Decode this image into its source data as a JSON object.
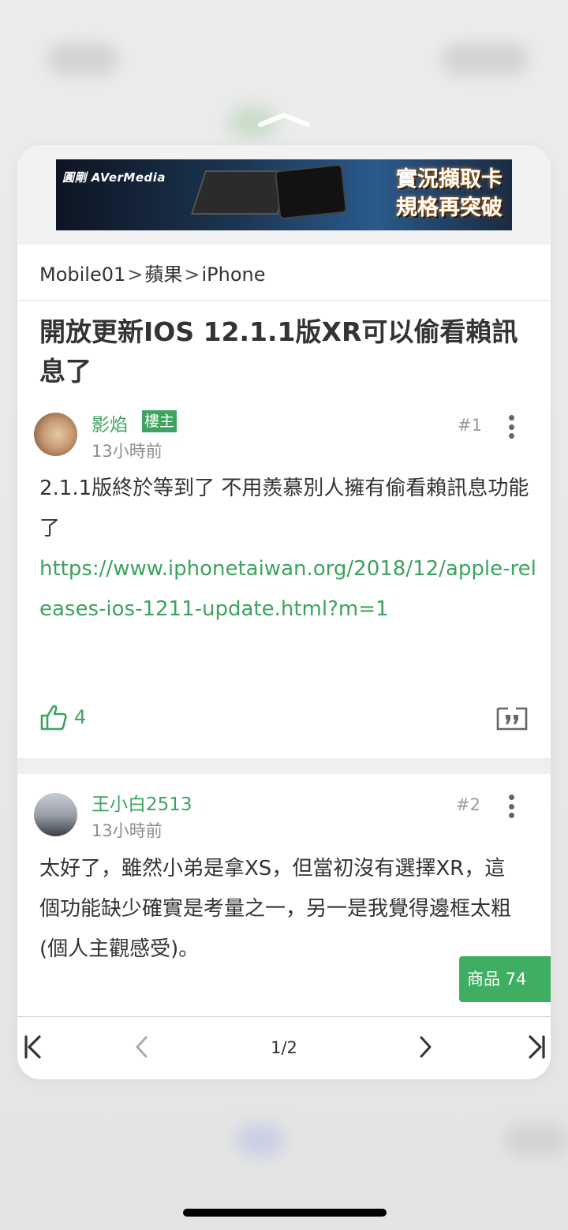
{
  "ad": {
    "brand": "圓剛 AVerMedia",
    "slogan_line1": "實況擷取卡",
    "slogan_line2": "規格再突破"
  },
  "breadcrumb": [
    "Mobile01",
    "蘋果",
    "iPhone"
  ],
  "breadcrumb_separator": ">",
  "thread_title": "開放更新IOS 12.1.1版XR可以偷看賴訊息了",
  "posts": [
    {
      "username": "影焰",
      "op_badge": "樓主",
      "time": "13小時前",
      "floor": "#1",
      "body": "2.1.1版終於等到了 不用羨慕別人擁有偷看賴訊息功能了",
      "link": "https://www.iphonetaiwan.org/2018/12/apple-releases-ios-1211-update.html?m=1",
      "likes": "4"
    },
    {
      "username": "王小白2513",
      "time": "13小時前",
      "floor": "#2",
      "body": "太好了，雖然小弟是拿XS，但當初沒有選擇XR，這個功能缺少確實是考量之一，另一是我覺得邊框太粗(個人主觀感受)。"
    }
  ],
  "float_tag": "商品 74",
  "pager": {
    "page": "1/2"
  },
  "colors": {
    "accent_green": "#3da35f",
    "float_tag_bg": "#3fae62"
  },
  "icons": [
    "grabber-chevron-icon",
    "more-vertical-icon",
    "thumbs-up-icon",
    "quote-icon",
    "first-page-icon",
    "prev-page-icon",
    "next-page-icon",
    "last-page-icon"
  ]
}
